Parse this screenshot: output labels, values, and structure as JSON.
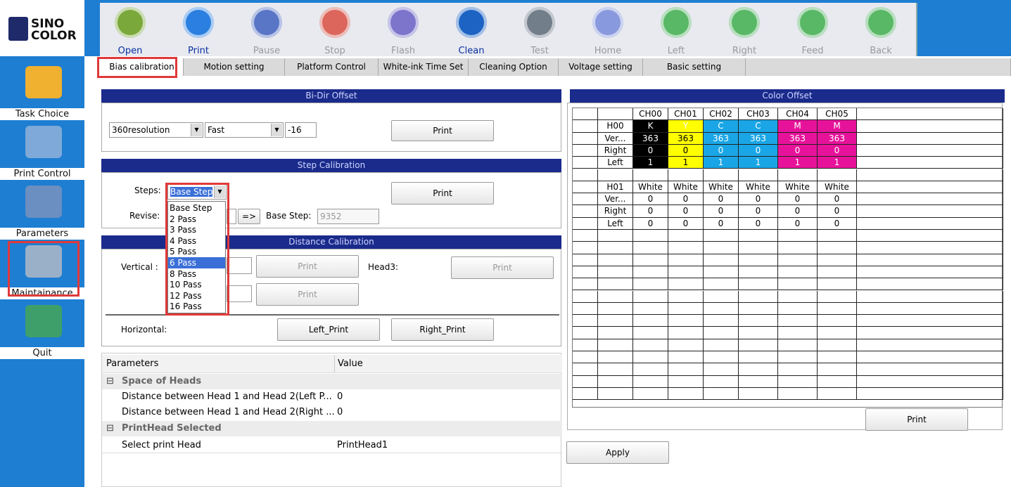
{
  "brand": {
    "line1": "SINO",
    "line2": "COLOR"
  },
  "toolbar": [
    {
      "label": "Open",
      "enabled": true,
      "icon": "folder-icon",
      "color": "#7aa83a"
    },
    {
      "label": "Print",
      "enabled": true,
      "icon": "play-icon",
      "color": "#2b7fe0"
    },
    {
      "label": "Pause",
      "enabled": false,
      "icon": "pause-icon",
      "color": "#2a4fb8"
    },
    {
      "label": "Stop",
      "enabled": false,
      "icon": "stop-icon",
      "color": "#d83a2a"
    },
    {
      "label": "Flash",
      "enabled": false,
      "icon": "flash-icon",
      "color": "#5a4fc0"
    },
    {
      "label": "Clean",
      "enabled": true,
      "icon": "bottle-icon",
      "color": "#1d63c4"
    },
    {
      "label": "Test",
      "enabled": false,
      "icon": "test-page-icon",
      "color": "#4d5a6a"
    },
    {
      "label": "Home",
      "enabled": false,
      "icon": "home-icon",
      "color": "#6a7fd8"
    },
    {
      "label": "Left",
      "enabled": false,
      "icon": "arrow-left-icon",
      "color": "#2aa838"
    },
    {
      "label": "Right",
      "enabled": false,
      "icon": "arrow-right-icon",
      "color": "#2aa838"
    },
    {
      "label": "Feed",
      "enabled": false,
      "icon": "arrow-down-icon",
      "color": "#2aa838"
    },
    {
      "label": "Back",
      "enabled": false,
      "icon": "arrow-up-icon",
      "color": "#2aa838"
    }
  ],
  "sidebar": [
    {
      "label": "Task Choice",
      "icon": "folder-icon"
    },
    {
      "label": "Print Control",
      "icon": "print-control-icon"
    },
    {
      "label": "Parameters",
      "icon": "gear-icon"
    },
    {
      "label": "Maintainance",
      "icon": "tools-icon"
    },
    {
      "label": "Quit",
      "icon": "quit-user-icon"
    }
  ],
  "tabs": [
    "Bias calibration",
    "Motion setting",
    "Platform Control",
    "White-ink Time Set",
    "Cleaning Option",
    "Voltage setting",
    "Basic setting"
  ],
  "bidir": {
    "title": "Bi-Dir Offset",
    "resolution": "360resolution",
    "speed": "Fast",
    "offset": "-16",
    "print": "Print"
  },
  "step": {
    "title": "Step Calibration",
    "steps_label": "Steps:",
    "steps_value": "Base Step",
    "revise_label": "Revise:",
    "arrow": "=>",
    "base_label": "Base Step:",
    "base_value": "9352",
    "print": "Print",
    "options": [
      "Base Step",
      "2 Pass",
      "3 Pass",
      "4 Pass",
      "5 Pass",
      "6 Pass",
      "8 Pass",
      "10 Pass",
      "12 Pass",
      "16 Pass"
    ],
    "selected_option": "6 Pass"
  },
  "distance": {
    "title": "Distance  Calibration",
    "vertical_label": "Vertical :",
    "print1": "Print",
    "print2": "Print",
    "head3_label": "Head3:",
    "print3": "Print",
    "horizontal_label": "Horizontal:",
    "left_print": "Left_Print",
    "right_print": "Right_Print"
  },
  "props": {
    "col1": "Parameters",
    "col2": "Value",
    "group1": "Space of Heads",
    "row1_name": "Distance between Head 1 and Head 2(Left P...",
    "row1_val": "0",
    "row2_name": "Distance between Head 1 and Head 2(Right ...",
    "row2_val": "0",
    "group2": "PrintHead Selected",
    "row3_name": "Select print Head",
    "row3_val": "PrintHead1",
    "collapse": "⊟"
  },
  "color_offset": {
    "title": "Color Offset",
    "print": "Print",
    "channels": [
      "CH00",
      "CH01",
      "CH02",
      "CH03",
      "CH04",
      "CH05"
    ],
    "head0": {
      "name": "H00",
      "colors": [
        "K",
        "Y",
        "C",
        "C",
        "M",
        "M"
      ],
      "ver_label": "Ver...",
      "ver": [
        "363",
        "363",
        "363",
        "363",
        "363",
        "363"
      ],
      "right_label": "Right",
      "right": [
        "0",
        "0",
        "0",
        "0",
        "0",
        "0"
      ],
      "left_label": "Left",
      "left": [
        "1",
        "1",
        "1",
        "1",
        "1",
        "1"
      ]
    },
    "head1": {
      "name": "H01",
      "colors": [
        "White",
        "White",
        "White",
        "White",
        "White",
        "White"
      ],
      "ver_label": "Ver...",
      "ver": [
        "0",
        "0",
        "0",
        "0",
        "0",
        "0"
      ],
      "right_label": "Right",
      "right": [
        "0",
        "0",
        "0",
        "0",
        "0",
        "0"
      ],
      "left_label": "Left",
      "left": [
        "0",
        "0",
        "0",
        "0",
        "0",
        "0"
      ]
    },
    "cell_colors": {
      "K": "#000000",
      "Y": "#ffff00",
      "C": "#1aa6e6",
      "M": "#e6139a"
    }
  },
  "apply": "Apply"
}
